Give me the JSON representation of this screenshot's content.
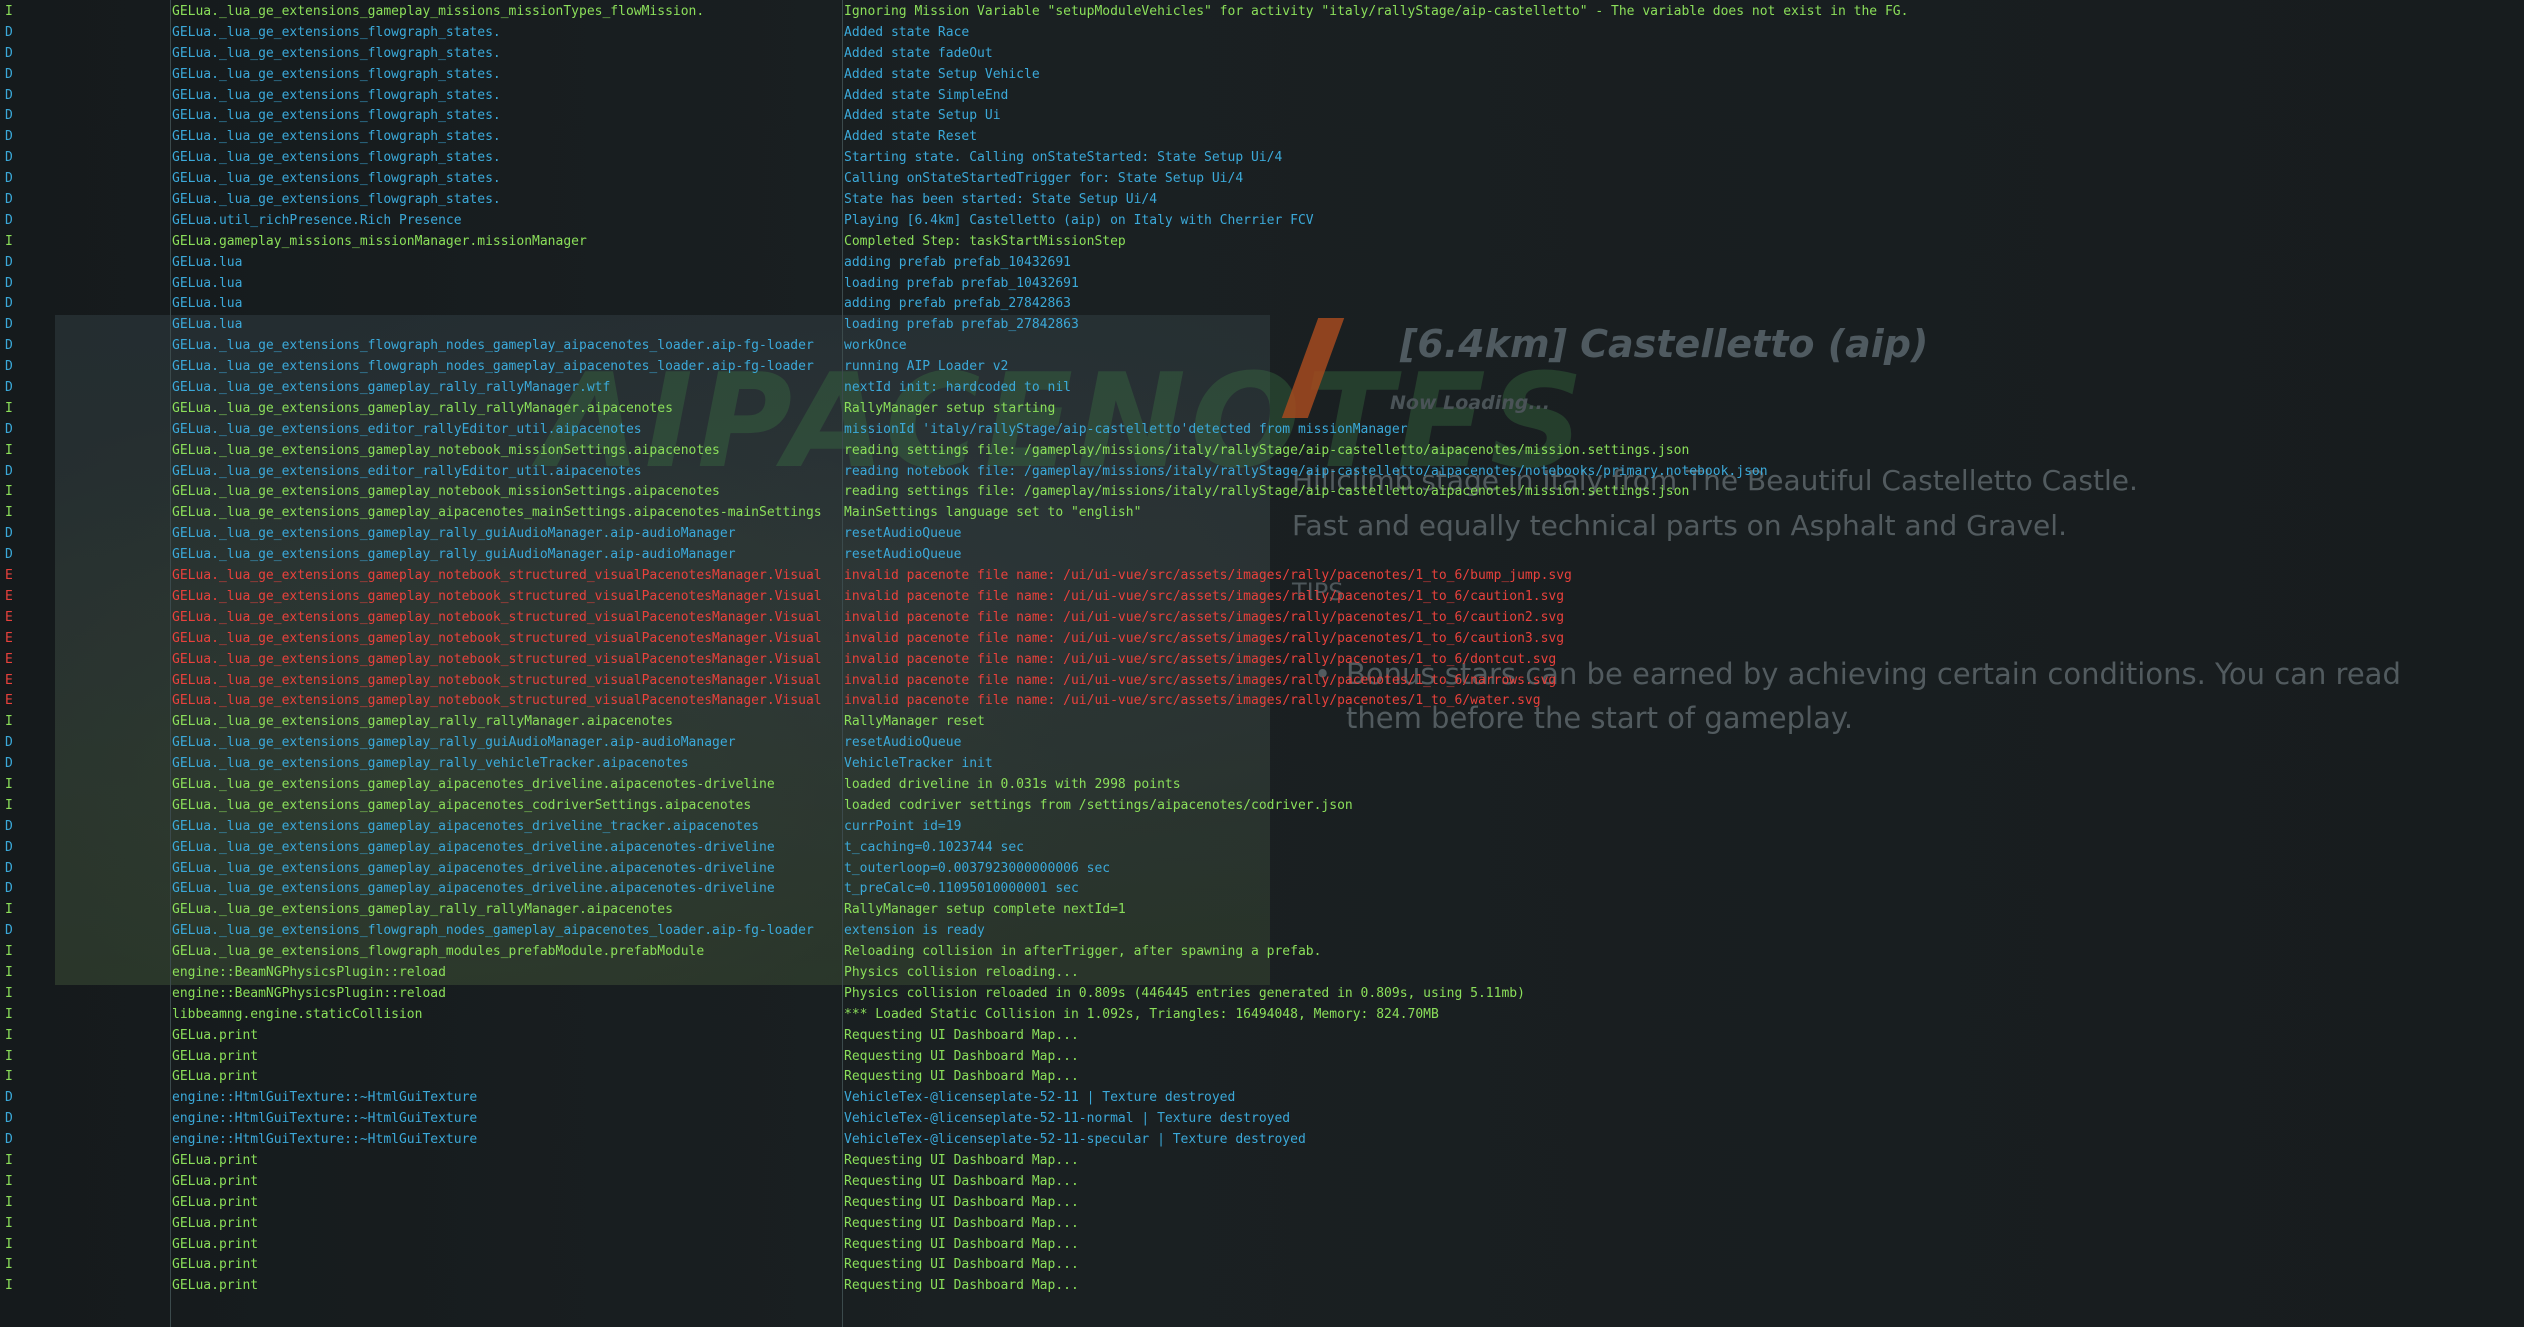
{
  "loading_screen": {
    "title": "[6.4km] Castelletto (aip)",
    "subtitle": "Now Loading...",
    "description": "Hillclimb stage in Italy from The Beautiful Castelletto Castle.\nFast and equally technical parts on Asphalt and Gravel.",
    "tips_heading": "TIPS",
    "tip_bullet": "•",
    "tip": "Bonus stars can be earned by achieving certain conditions. You can read them before the start of gameplay.",
    "background_logo": "AIPACENOTES"
  },
  "colors": {
    "info": "#8bdf5a",
    "debug": "#3ba9d9",
    "error": "#e8413c",
    "background": "#14191b"
  },
  "log_lines": [
    {
      "level": "I",
      "source": "GELua._lua_ge_extensions_gameplay_missions_missionTypes_flowMission.",
      "message": "Ignoring Mission Variable \"setupModuleVehicles\" for activity \"italy/rallyStage/aip-castelletto\" - The variable does not exist in the FG."
    },
    {
      "level": "D",
      "source": "GELua._lua_ge_extensions_flowgraph_states.",
      "message": "Added state Race"
    },
    {
      "level": "D",
      "source": "GELua._lua_ge_extensions_flowgraph_states.",
      "message": "Added state fadeOut"
    },
    {
      "level": "D",
      "source": "GELua._lua_ge_extensions_flowgraph_states.",
      "message": "Added state Setup Vehicle"
    },
    {
      "level": "D",
      "source": "GELua._lua_ge_extensions_flowgraph_states.",
      "message": "Added state SimpleEnd"
    },
    {
      "level": "D",
      "source": "GELua._lua_ge_extensions_flowgraph_states.",
      "message": "Added state Setup Ui"
    },
    {
      "level": "D",
      "source": "GELua._lua_ge_extensions_flowgraph_states.",
      "message": "Added state Reset"
    },
    {
      "level": "D",
      "source": "GELua._lua_ge_extensions_flowgraph_states.",
      "message": "Starting state. Calling onStateStarted: State Setup Ui/4"
    },
    {
      "level": "D",
      "source": "GELua._lua_ge_extensions_flowgraph_states.",
      "message": "Calling onStateStartedTrigger for: State Setup Ui/4"
    },
    {
      "level": "D",
      "source": "GELua._lua_ge_extensions_flowgraph_states.",
      "message": "State has been started: State Setup Ui/4"
    },
    {
      "level": "D",
      "source": "GELua.util_richPresence.Rich Presence",
      "message": "Playing [6.4km] Castelletto (aip) on Italy with Cherrier FCV"
    },
    {
      "level": "I",
      "source": "GELua.gameplay_missions_missionManager.missionManager",
      "message": "Completed Step: taskStartMissionStep"
    },
    {
      "level": "D",
      "source": "GELua.lua",
      "message": "adding prefab prefab_10432691"
    },
    {
      "level": "D",
      "source": "GELua.lua",
      "message": "loading prefab prefab_10432691"
    },
    {
      "level": "D",
      "source": "GELua.lua",
      "message": "adding prefab prefab_27842863"
    },
    {
      "level": "D",
      "source": "GELua.lua",
      "message": "loading prefab prefab_27842863"
    },
    {
      "level": "D",
      "source": "GELua._lua_ge_extensions_flowgraph_nodes_gameplay_aipacenotes_loader.aip-fg-loader",
      "message": "workOnce"
    },
    {
      "level": "D",
      "source": "GELua._lua_ge_extensions_flowgraph_nodes_gameplay_aipacenotes_loader.aip-fg-loader",
      "message": "running AIP Loader v2"
    },
    {
      "level": "D",
      "source": "GELua._lua_ge_extensions_gameplay_rally_rallyManager.wtf",
      "message": "nextId init: hardcoded to nil"
    },
    {
      "level": "I",
      "source": "GELua._lua_ge_extensions_gameplay_rally_rallyManager.aipacenotes",
      "message": "RallyManager setup starting"
    },
    {
      "level": "D",
      "source": "GELua._lua_ge_extensions_editor_rallyEditor_util.aipacenotes",
      "message": "missionId 'italy/rallyStage/aip-castelletto'detected from missionManager"
    },
    {
      "level": "I",
      "source": "GELua._lua_ge_extensions_gameplay_notebook_missionSettings.aipacenotes",
      "message": "reading settings file: /gameplay/missions/italy/rallyStage/aip-castelletto/aipacenotes/mission.settings.json"
    },
    {
      "level": "D",
      "source": "GELua._lua_ge_extensions_editor_rallyEditor_util.aipacenotes",
      "message": "reading notebook file: /gameplay/missions/italy/rallyStage/aip-castelletto/aipacenotes/notebooks/primary.notebook.json"
    },
    {
      "level": "I",
      "source": "GELua._lua_ge_extensions_gameplay_notebook_missionSettings.aipacenotes",
      "message": "reading settings file: /gameplay/missions/italy/rallyStage/aip-castelletto/aipacenotes/mission.settings.json"
    },
    {
      "level": "I",
      "source": "GELua._lua_ge_extensions_gameplay_aipacenotes_mainSettings.aipacenotes-mainSettings",
      "message": "MainSettings language set to \"english\""
    },
    {
      "level": "D",
      "source": "GELua._lua_ge_extensions_gameplay_rally_guiAudioManager.aip-audioManager",
      "message": "resetAudioQueue"
    },
    {
      "level": "D",
      "source": "GELua._lua_ge_extensions_gameplay_rally_guiAudioManager.aip-audioManager",
      "message": "resetAudioQueue"
    },
    {
      "level": "E",
      "source": "GELua._lua_ge_extensions_gameplay_notebook_structured_visualPacenotesManager.Visual",
      "message": "invalid pacenote file name: /ui/ui-vue/src/assets/images/rally/pacenotes/1_to_6/bump_jump.svg"
    },
    {
      "level": "E",
      "source": "GELua._lua_ge_extensions_gameplay_notebook_structured_visualPacenotesManager.Visual",
      "message": "invalid pacenote file name: /ui/ui-vue/src/assets/images/rally/pacenotes/1_to_6/caution1.svg"
    },
    {
      "level": "E",
      "source": "GELua._lua_ge_extensions_gameplay_notebook_structured_visualPacenotesManager.Visual",
      "message": "invalid pacenote file name: /ui/ui-vue/src/assets/images/rally/pacenotes/1_to_6/caution2.svg"
    },
    {
      "level": "E",
      "source": "GELua._lua_ge_extensions_gameplay_notebook_structured_visualPacenotesManager.Visual",
      "message": "invalid pacenote file name: /ui/ui-vue/src/assets/images/rally/pacenotes/1_to_6/caution3.svg"
    },
    {
      "level": "E",
      "source": "GELua._lua_ge_extensions_gameplay_notebook_structured_visualPacenotesManager.Visual",
      "message": "invalid pacenote file name: /ui/ui-vue/src/assets/images/rally/pacenotes/1_to_6/dontcut.svg"
    },
    {
      "level": "E",
      "source": "GELua._lua_ge_extensions_gameplay_notebook_structured_visualPacenotesManager.Visual",
      "message": "invalid pacenote file name: /ui/ui-vue/src/assets/images/rally/pacenotes/1_to_6/narrows.svg"
    },
    {
      "level": "E",
      "source": "GELua._lua_ge_extensions_gameplay_notebook_structured_visualPacenotesManager.Visual",
      "message": "invalid pacenote file name: /ui/ui-vue/src/assets/images/rally/pacenotes/1_to_6/water.svg"
    },
    {
      "level": "I",
      "source": "GELua._lua_ge_extensions_gameplay_rally_rallyManager.aipacenotes",
      "message": "RallyManager reset"
    },
    {
      "level": "D",
      "source": "GELua._lua_ge_extensions_gameplay_rally_guiAudioManager.aip-audioManager",
      "message": "resetAudioQueue"
    },
    {
      "level": "D",
      "source": "GELua._lua_ge_extensions_gameplay_rally_vehicleTracker.aipacenotes",
      "message": "VehicleTracker init"
    },
    {
      "level": "I",
      "source": "GELua._lua_ge_extensions_gameplay_aipacenotes_driveline.aipacenotes-driveline",
      "message": "loaded driveline in 0.031s with 2998 points"
    },
    {
      "level": "I",
      "source": "GELua._lua_ge_extensions_gameplay_aipacenotes_codriverSettings.aipacenotes",
      "message": "loaded codriver settings from /settings/aipacenotes/codriver.json"
    },
    {
      "level": "D",
      "source": "GELua._lua_ge_extensions_gameplay_aipacenotes_driveline_tracker.aipacenotes",
      "message": "currPoint id=19"
    },
    {
      "level": "D",
      "source": "GELua._lua_ge_extensions_gameplay_aipacenotes_driveline.aipacenotes-driveline",
      "message": "t_caching=0.1023744 sec"
    },
    {
      "level": "D",
      "source": "GELua._lua_ge_extensions_gameplay_aipacenotes_driveline.aipacenotes-driveline",
      "message": "t_outerloop=0.0037923000000006 sec"
    },
    {
      "level": "D",
      "source": "GELua._lua_ge_extensions_gameplay_aipacenotes_driveline.aipacenotes-driveline",
      "message": "t_preCalc=0.11095010000001 sec"
    },
    {
      "level": "I",
      "source": "GELua._lua_ge_extensions_gameplay_rally_rallyManager.aipacenotes",
      "message": "RallyManager setup complete nextId=1"
    },
    {
      "level": "D",
      "source": "GELua._lua_ge_extensions_flowgraph_nodes_gameplay_aipacenotes_loader.aip-fg-loader",
      "message": "extension is ready"
    },
    {
      "level": "I",
      "source": "GELua._lua_ge_extensions_flowgraph_modules_prefabModule.prefabModule",
      "message": "Reloading collision in afterTrigger, after spawning a prefab."
    },
    {
      "level": "I",
      "source": "engine::BeamNGPhysicsPlugin::reload",
      "message": "Physics collision reloading..."
    },
    {
      "level": "I",
      "source": "engine::BeamNGPhysicsPlugin::reload",
      "message": "Physics collision reloaded in 0.809s (446445 entries generated in 0.809s, using  5.11mb)"
    },
    {
      "level": "I",
      "source": "libbeamng.engine.staticCollision",
      "message": "*** Loaded Static Collision in 1.092s, Triangles: 16494048, Memory: 824.70MB"
    },
    {
      "level": "I",
      "source": "GELua.print",
      "message": "Requesting UI Dashboard Map..."
    },
    {
      "level": "I",
      "source": "GELua.print",
      "message": "Requesting UI Dashboard Map..."
    },
    {
      "level": "I",
      "source": "GELua.print",
      "message": "Requesting UI Dashboard Map..."
    },
    {
      "level": "D",
      "source": "engine::HtmlGuiTexture::~HtmlGuiTexture",
      "message": "VehicleTex-@licenseplate-52-11 | Texture destroyed"
    },
    {
      "level": "D",
      "source": "engine::HtmlGuiTexture::~HtmlGuiTexture",
      "message": "VehicleTex-@licenseplate-52-11-normal | Texture destroyed"
    },
    {
      "level": "D",
      "source": "engine::HtmlGuiTexture::~HtmlGuiTexture",
      "message": "VehicleTex-@licenseplate-52-11-specular | Texture destroyed"
    },
    {
      "level": "I",
      "source": "GELua.print",
      "message": "Requesting UI Dashboard Map..."
    },
    {
      "level": "I",
      "source": "GELua.print",
      "message": "Requesting UI Dashboard Map..."
    },
    {
      "level": "I",
      "source": "GELua.print",
      "message": "Requesting UI Dashboard Map..."
    },
    {
      "level": "I",
      "source": "GELua.print",
      "message": "Requesting UI Dashboard Map..."
    },
    {
      "level": "I",
      "source": "GELua.print",
      "message": "Requesting UI Dashboard Map..."
    },
    {
      "level": "I",
      "source": "GELua.print",
      "message": "Requesting UI Dashboard Map..."
    },
    {
      "level": "I",
      "source": "GELua.print",
      "message": "Requesting UI Dashboard Map..."
    }
  ]
}
